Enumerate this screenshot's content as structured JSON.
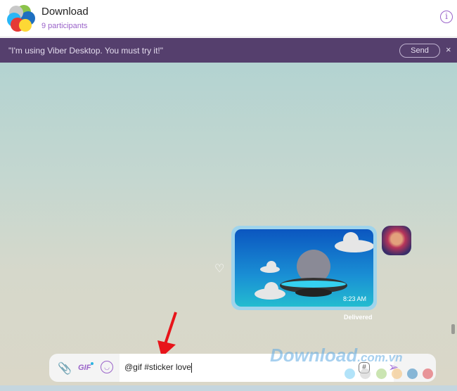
{
  "header": {
    "title": "Download",
    "participants": "9 participants"
  },
  "banner": {
    "message": "\"I'm using Viber Desktop. You must try it!\"",
    "send_label": "Send",
    "close_label": "×"
  },
  "message": {
    "time": "8:23 AM",
    "status": "Delivered"
  },
  "composer": {
    "gif_label": "GIF",
    "text": "@gif #sticker love",
    "hash_label": "#"
  },
  "watermark": {
    "text": "Download",
    ".tld": ".com.vn"
  },
  "colors": {
    "accent": "#9a63c9",
    "banner": "#553f6d",
    "bubble": "#9fd4ec"
  }
}
